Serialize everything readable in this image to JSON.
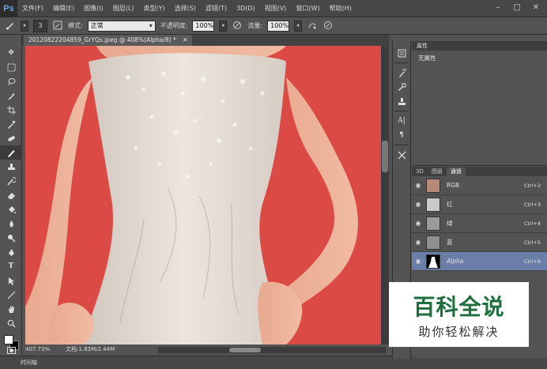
{
  "menubar": {
    "logo": "Ps",
    "items": [
      "文件(F)",
      "编辑(E)",
      "图像(I)",
      "图层(L)",
      "类型(Y)",
      "选择(S)",
      "滤镜(T)",
      "3D(D)",
      "视图(V)",
      "窗口(W)",
      "帮助(H)"
    ],
    "window_controls": [
      "–",
      "□",
      "✕"
    ]
  },
  "options": {
    "brush_size": "3",
    "mode_label": "模式:",
    "mode_value": "正常",
    "opacity_label": "不透明度:",
    "opacity_value": "100%",
    "flow_label": "流量:",
    "flow_value": "100%"
  },
  "document": {
    "tab_title": "20120822204859_GrYQs.jpeg @ 408%(Alpha/8) *",
    "zoom": "407.73%",
    "doc_info": "文档:1.83M/2.44M"
  },
  "timeline": {
    "label": "时间轴"
  },
  "properties": {
    "header": "属性",
    "content": "无属性"
  },
  "channels_panel": {
    "tabs": [
      "3D",
      "图层",
      "通道"
    ],
    "active_tab": "通道",
    "channels": [
      {
        "name": "RGB",
        "shortcut": "Ctrl+2"
      },
      {
        "name": "红",
        "shortcut": "Ctrl+3"
      },
      {
        "name": "绿",
        "shortcut": "Ctrl+4"
      },
      {
        "name": "蓝",
        "shortcut": "Ctrl+5"
      },
      {
        "name": "Alpha",
        "shortcut": "Ctrl+6"
      }
    ]
  },
  "watermark": {
    "main": "百科全说",
    "sub": "助你轻松解决"
  },
  "colors": {
    "canvas_bg": "#dc4a45",
    "selected_channel": "#6b7ea7",
    "ps_blue": "#6fa6e8",
    "watermark_green": "#1f6f3e"
  }
}
